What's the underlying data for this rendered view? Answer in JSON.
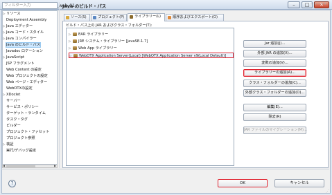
{
  "window": {
    "title": "プロパティー: Migration_web_01"
  },
  "filter": {
    "placeholder": "フィルター入力"
  },
  "tree": [
    {
      "label": "リソース",
      "arrow": "▷"
    },
    {
      "label": "Deployment Assembly",
      "arrow": ""
    },
    {
      "label": "Java エディター",
      "arrow": "▷"
    },
    {
      "label": "Java コード・スタイル",
      "arrow": "▷"
    },
    {
      "label": "Java コンパイラー",
      "arrow": "▷"
    },
    {
      "label": "Java のビルド・パス",
      "arrow": "",
      "selected": true
    },
    {
      "label": "Javadoc ロケーション",
      "arrow": ""
    },
    {
      "label": "JavaScript",
      "arrow": "▷"
    },
    {
      "label": "JSP フラグメント",
      "arrow": ""
    },
    {
      "label": "Web Content の設定",
      "arrow": ""
    },
    {
      "label": "Web プロジェクトの設定",
      "arrow": ""
    },
    {
      "label": "Web ページ・エディター",
      "arrow": ""
    },
    {
      "label": "WebOTXの設定",
      "arrow": ""
    },
    {
      "label": "XDoclet",
      "arrow": "▷"
    },
    {
      "label": "サーバー",
      "arrow": ""
    },
    {
      "label": "サービス・ポリシー",
      "arrow": ""
    },
    {
      "label": "ターゲット・ランタイム",
      "arrow": ""
    },
    {
      "label": "タスク・タグ",
      "arrow": ""
    },
    {
      "label": "ビルダー",
      "arrow": ""
    },
    {
      "label": "プロジェクト・ファセット",
      "arrow": ""
    },
    {
      "label": "プロジェクト参照",
      "arrow": ""
    },
    {
      "label": "検証",
      "arrow": "▷"
    },
    {
      "label": "実行/デバッグ設定",
      "arrow": ""
    }
  ],
  "page": {
    "title": "Java のビルド・パス",
    "tabs": [
      {
        "label": "ソース(S)",
        "active": false
      },
      {
        "label": "プロジェクト(P)",
        "active": false
      },
      {
        "label": "ライブラリー(L)",
        "active": true
      },
      {
        "label": "順序およびエクスポート(O)",
        "active": false
      }
    ],
    "panel_label": "ビルド・パス上の JAR およびクラス・フォルダー(T):",
    "libraries": [
      {
        "label": "EAR ライブラリー",
        "highlighted": false
      },
      {
        "label": "JRE システム・ライブラリー [JavaSE-1.7]",
        "highlighted": false
      },
      {
        "label": "Web App ライブラリー",
        "highlighted": false
      },
      {
        "label": "WebOTX Application Server(Local) [WebOTX Application Server v9(Local Default)]",
        "highlighted": true
      }
    ],
    "buttons": [
      {
        "label": "Jar 追加(J)...",
        "highlighted": false,
        "disabled": false
      },
      {
        "label": "外部 JAR の追加(X)...",
        "highlighted": false,
        "disabled": false
      },
      {
        "label": "変数の追加(V)...",
        "highlighted": false,
        "disabled": false
      },
      {
        "label": "ライブラリーの追加(A)...",
        "highlighted": true,
        "disabled": false
      },
      {
        "label": "クラス・フォルダーの追加(C)...",
        "highlighted": false,
        "disabled": false
      },
      {
        "label": "外部クラス・フォルダーの追加(O)...",
        "highlighted": false,
        "disabled": false
      },
      {
        "label": "編集(E)...",
        "highlighted": false,
        "disabled": false
      },
      {
        "label": "除去(R)",
        "highlighted": false,
        "disabled": false
      },
      {
        "label": "JAR ファイルのマイグレーション(M)...",
        "highlighted": false,
        "disabled": true
      }
    ]
  },
  "footer": {
    "help": "?",
    "ok": "OK",
    "cancel": "キャンセル"
  }
}
